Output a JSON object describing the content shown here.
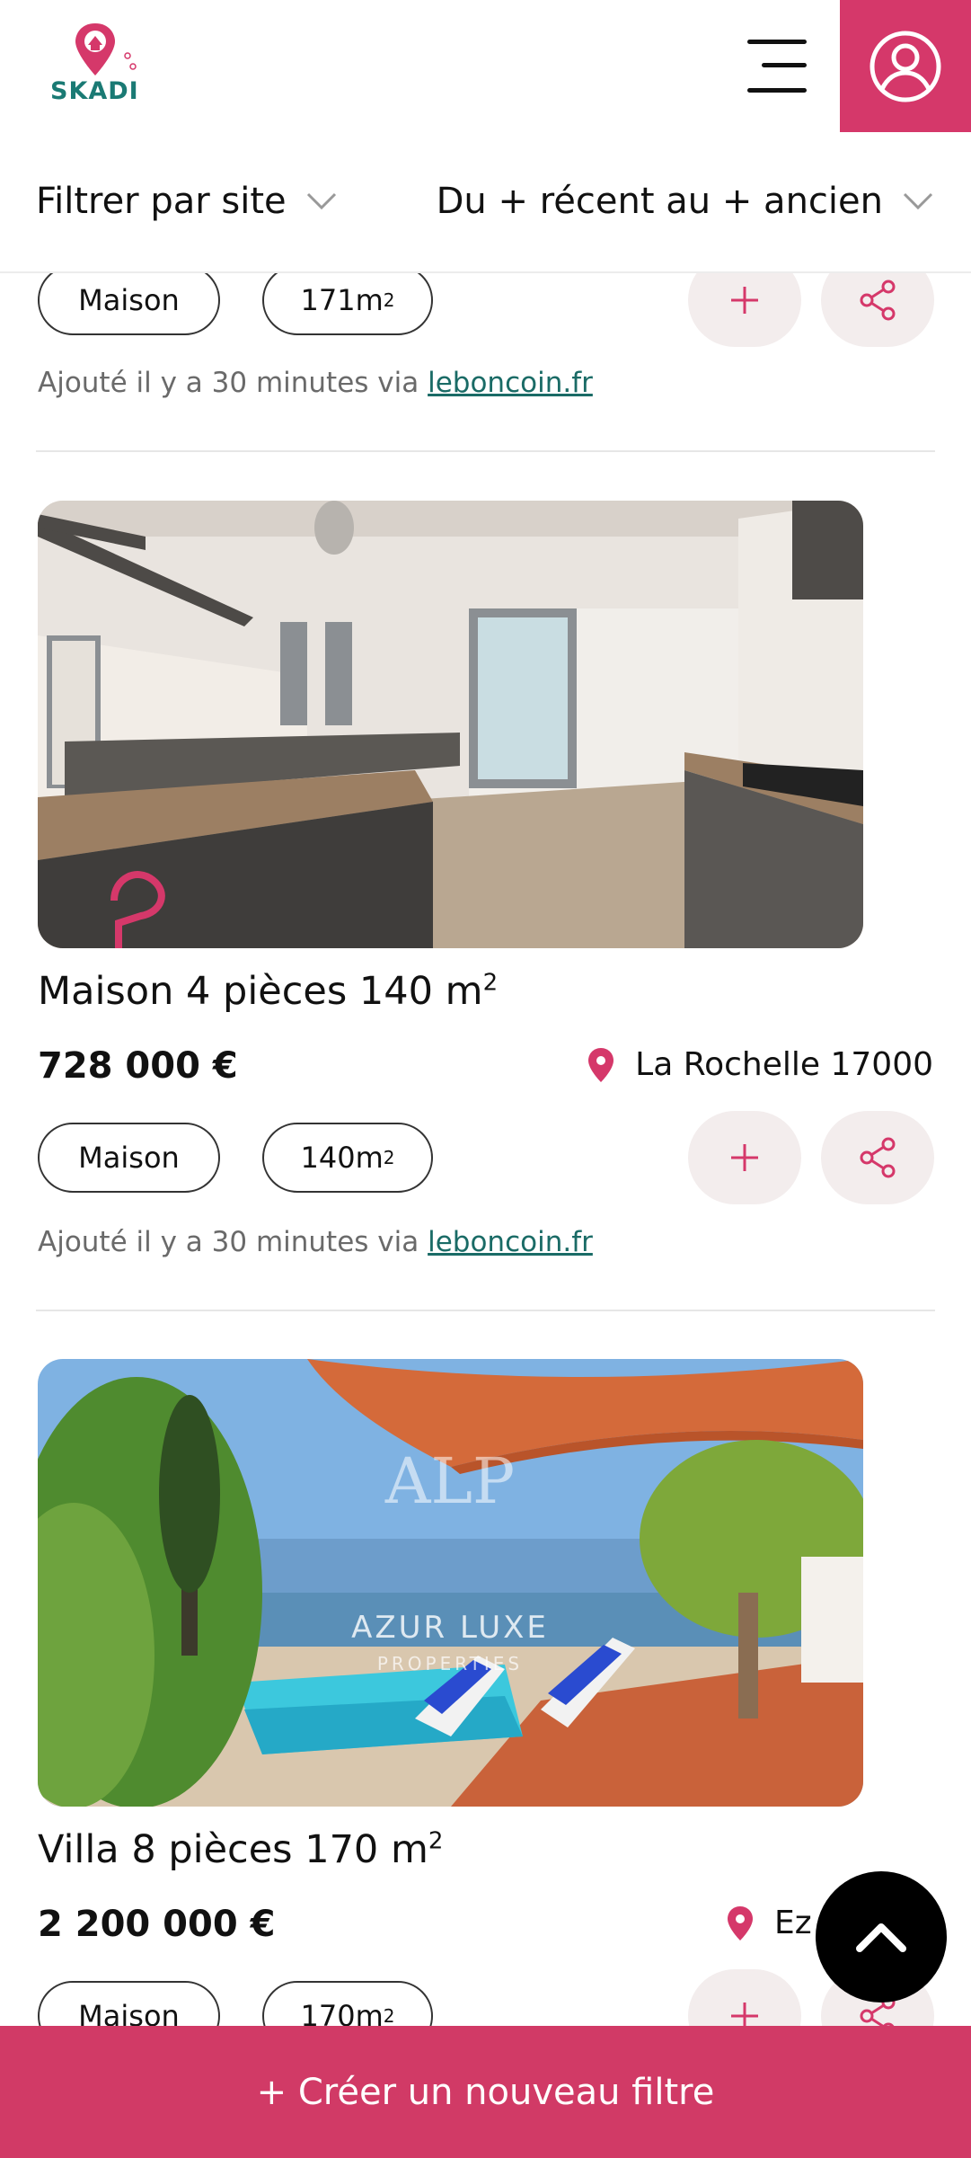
{
  "app": {
    "logo_text": "SKADI",
    "accent_color": "#d5386a",
    "teal_color": "#1a7a74"
  },
  "filters": {
    "site_label": "Filtrer par site",
    "sort_label": "Du + récent au + ancien"
  },
  "listings": [
    {
      "type": "Maison",
      "area": "171m",
      "area_unit": "2",
      "added_text": "Ajouté il y a 30 minutes via ",
      "source": "leboncoin.fr"
    },
    {
      "title": "Maison 4 pièces 140 m",
      "title_unit": "2",
      "price": "728 000 €",
      "location": "La Rochelle 17000",
      "type": "Maison",
      "area": "140m",
      "area_unit": "2",
      "added_text": "Ajouté il y a 30 minutes via ",
      "source": "leboncoin.fr",
      "image": "modern-kitchen-photo"
    },
    {
      "title": "Villa 8 pièces 170 m",
      "title_unit": "2",
      "price": "2 200 000 €",
      "location": "Ez",
      "type": "Maison",
      "area": "170m",
      "area_unit": "2",
      "image": "pool-terrace-photo",
      "watermark_logo": "ALP",
      "watermark_name": "AZUR LUXE",
      "watermark_sub": "PROPERTIES"
    }
  ],
  "cta": {
    "create_filter": "+ Créer un nouveau filtre"
  }
}
